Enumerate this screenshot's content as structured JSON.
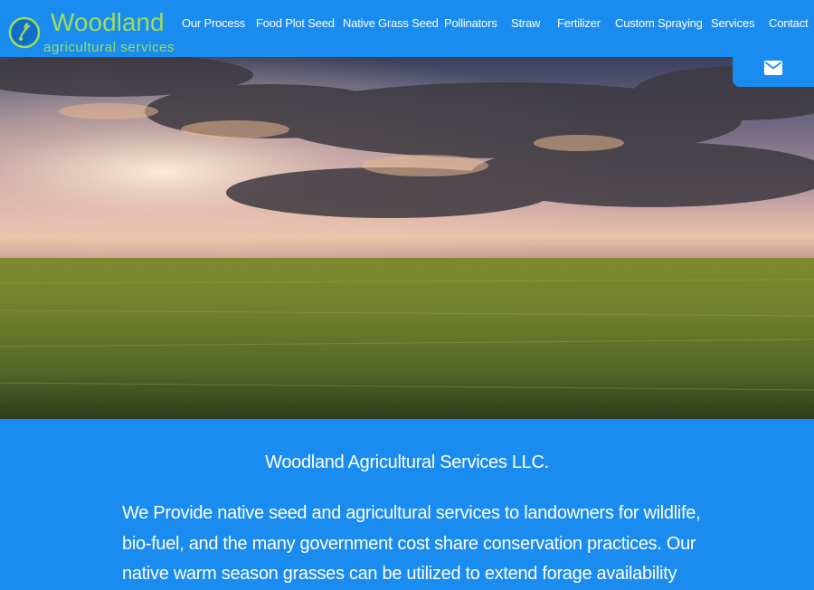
{
  "brand": {
    "name": "Woodland",
    "tagline": "agricultural services",
    "green": "#9ddc5a"
  },
  "nav": {
    "items": [
      {
        "label": "Our Process"
      },
      {
        "label": "Food Plot Seed"
      },
      {
        "label": "Native Grass Seed"
      },
      {
        "label": "Pollinators"
      },
      {
        "label": "Straw"
      },
      {
        "label": "Fertilizer"
      },
      {
        "label": "Custom Spraying"
      },
      {
        "label": "Services"
      },
      {
        "label": "Contact"
      }
    ]
  },
  "mail_button": {
    "icon": "envelope-icon"
  },
  "hero": {
    "image": "prairie-wheat-field-sunset"
  },
  "main": {
    "company_name": "Woodland Agricultural Services LLC.",
    "intro": "We Provide native seed and agricultural services to landowners for wildlife, bio-fuel, and the many government cost share conservation practices. Our native warm season grasses can be utilized to extend forage availability"
  },
  "colors": {
    "accent": "#1a8cf0",
    "text": "#ffffff"
  }
}
